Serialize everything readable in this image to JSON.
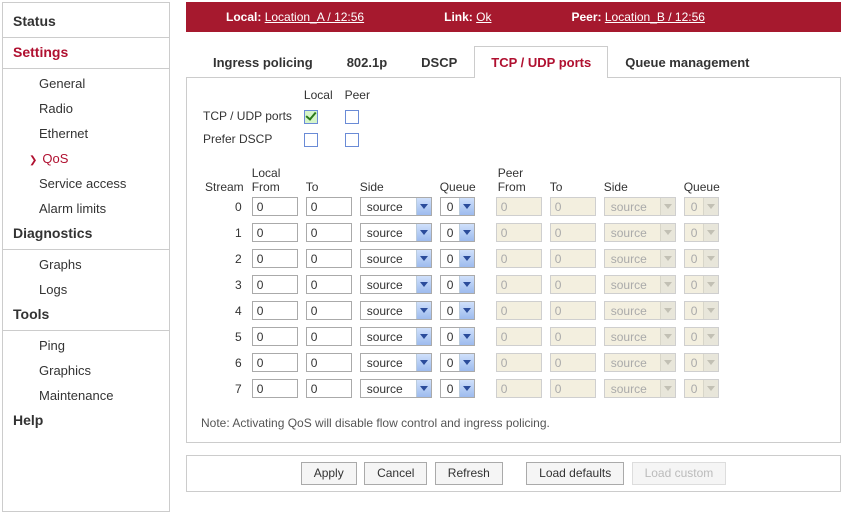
{
  "nav": {
    "status": "Status",
    "settings": "Settings",
    "general": "General",
    "radio": "Radio",
    "ethernet": "Ethernet",
    "qos": "QoS",
    "service_access": "Service access",
    "alarm_limits": "Alarm limits",
    "diagnostics": "Diagnostics",
    "graphs": "Graphs",
    "logs": "Logs",
    "tools": "Tools",
    "ping": "Ping",
    "graphics": "Graphics",
    "maintenance": "Maintenance",
    "help": "Help"
  },
  "status_bar": {
    "local_label": "Local:",
    "local_value": "Location_A / 12:56",
    "link_label": "Link:",
    "link_value": "Ok",
    "peer_label": "Peer:",
    "peer_value": "Location_B / 12:56"
  },
  "tabs": {
    "ingress": "Ingress policing",
    "dot1p": "802.1p",
    "dscp": "DSCP",
    "tcpudp": "TCP / UDP ports",
    "queue_mgmt": "Queue management"
  },
  "top_opts": {
    "tcpudp_label": "TCP / UDP ports",
    "prefer_dscp_label": "Prefer DSCP",
    "local_hdr": "Local",
    "peer_hdr": "Peer"
  },
  "streams": {
    "hdr_stream": "Stream",
    "hdr_from": "From",
    "hdr_to": "To",
    "hdr_side": "Side",
    "hdr_queue": "Queue",
    "hdr_local": "Local",
    "hdr_peer": "Peer",
    "rows": [
      {
        "idx": "0",
        "lf": "0",
        "lt": "0",
        "ls": "source",
        "lq": "0",
        "pf": "0",
        "pt": "0",
        "ps": "source",
        "pq": "0"
      },
      {
        "idx": "1",
        "lf": "0",
        "lt": "0",
        "ls": "source",
        "lq": "0",
        "pf": "0",
        "pt": "0",
        "ps": "source",
        "pq": "0"
      },
      {
        "idx": "2",
        "lf": "0",
        "lt": "0",
        "ls": "source",
        "lq": "0",
        "pf": "0",
        "pt": "0",
        "ps": "source",
        "pq": "0"
      },
      {
        "idx": "3",
        "lf": "0",
        "lt": "0",
        "ls": "source",
        "lq": "0",
        "pf": "0",
        "pt": "0",
        "ps": "source",
        "pq": "0"
      },
      {
        "idx": "4",
        "lf": "0",
        "lt": "0",
        "ls": "source",
        "lq": "0",
        "pf": "0",
        "pt": "0",
        "ps": "source",
        "pq": "0"
      },
      {
        "idx": "5",
        "lf": "0",
        "lt": "0",
        "ls": "source",
        "lq": "0",
        "pf": "0",
        "pt": "0",
        "ps": "source",
        "pq": "0"
      },
      {
        "idx": "6",
        "lf": "0",
        "lt": "0",
        "ls": "source",
        "lq": "0",
        "pf": "0",
        "pt": "0",
        "ps": "source",
        "pq": "0"
      },
      {
        "idx": "7",
        "lf": "0",
        "lt": "0",
        "ls": "source",
        "lq": "0",
        "pf": "0",
        "pt": "0",
        "ps": "source",
        "pq": "0"
      }
    ]
  },
  "note": "Note: Activating QoS will disable flow control and ingress policing.",
  "buttons": {
    "apply": "Apply",
    "cancel": "Cancel",
    "refresh": "Refresh",
    "load_defaults": "Load defaults",
    "load_custom": "Load custom"
  }
}
